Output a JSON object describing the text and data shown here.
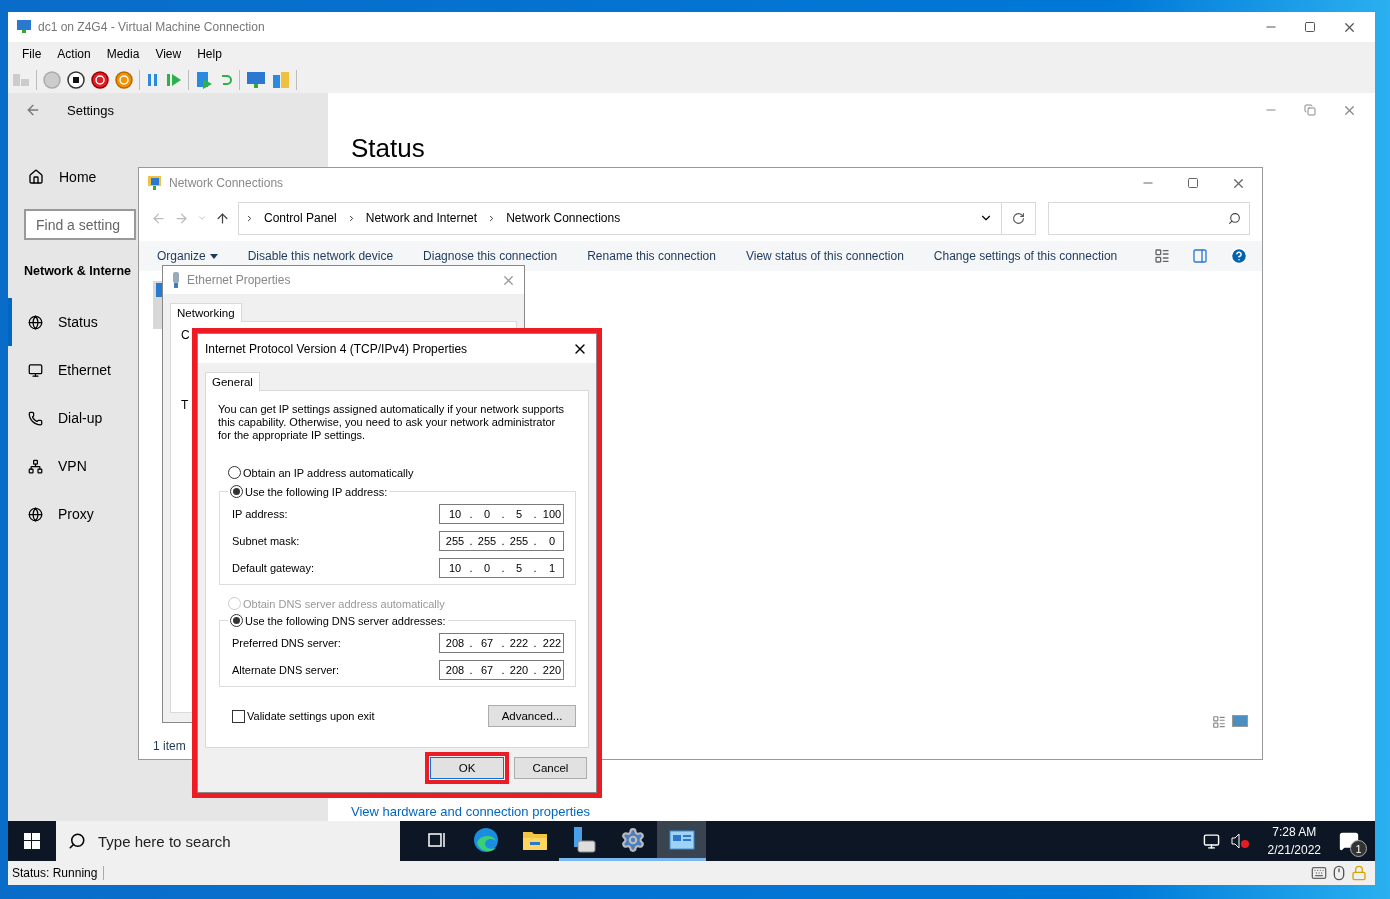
{
  "vm_window": {
    "title": "dc1 on Z4G4 - Virtual Machine Connection",
    "menu": [
      "File",
      "Action",
      "Media",
      "View",
      "Help"
    ],
    "status": "Status: Running"
  },
  "settings": {
    "title": "Settings",
    "home": "Home",
    "search": {
      "placeholder": "Find a setting"
    },
    "section": "Network & Interne",
    "heading": "Status",
    "link": "View hardware and connection properties",
    "nav": [
      {
        "label": "Status",
        "kind": "globe",
        "selected": true
      },
      {
        "label": "Ethernet",
        "kind": "ethernet",
        "selected": false
      },
      {
        "label": "Dial-up",
        "kind": "dialup",
        "selected": false
      },
      {
        "label": "VPN",
        "kind": "vpn",
        "selected": false
      },
      {
        "label": "Proxy",
        "kind": "globe",
        "selected": false
      }
    ]
  },
  "network_connections": {
    "title": "Network Connections",
    "breadcrumb": [
      "Control Panel",
      "Network and Internet",
      "Network Connections"
    ],
    "commands": [
      {
        "label": "Organize",
        "dropdown": true
      },
      {
        "label": "Disable this network device",
        "dropdown": false
      },
      {
        "label": "Diagnose this connection",
        "dropdown": false
      },
      {
        "label": "Rename this connection",
        "dropdown": false
      },
      {
        "label": "View status of this connection",
        "dropdown": false
      },
      {
        "label": "Change settings of this connection",
        "dropdown": false
      }
    ],
    "status": "1 item"
  },
  "ethernet_properties": {
    "title": "Ethernet Properties",
    "tabs": [
      {
        "label": "Networking",
        "selected": true
      }
    ],
    "fragments": [
      "C",
      "T"
    ]
  },
  "ipv4": {
    "title": "Internet Protocol Version 4 (TCP/IPv4) Properties",
    "tabs": [
      {
        "label": "General",
        "selected": true
      }
    ],
    "intro": "You can get IP settings assigned automatically if your network supports this capability. Otherwise, you need to ask your network administrator for the appropriate IP settings.",
    "separator": ".",
    "ip_auto": {
      "label": "Obtain an IP address automatically",
      "selected": false,
      "disabled": false
    },
    "ip_manual": {
      "label": "Use the following IP address:",
      "selected": true,
      "disabled": false
    },
    "ip_fields": [
      {
        "label": "IP address:",
        "octets": [
          "10",
          "0",
          "5",
          "100"
        ]
      },
      {
        "label": "Subnet mask:",
        "octets": [
          "255",
          "255",
          "255",
          "0"
        ]
      },
      {
        "label": "Default gateway:",
        "octets": [
          "10",
          "0",
          "5",
          "1"
        ]
      }
    ],
    "dns_auto": {
      "label": "Obtain DNS server address automatically",
      "selected": false,
      "disabled": true
    },
    "dns_manual": {
      "label": "Use the following DNS server addresses:",
      "selected": true,
      "disabled": false
    },
    "dns_fields": [
      {
        "label": "Preferred DNS server:",
        "octets": [
          "208",
          "67",
          "222",
          "222"
        ]
      },
      {
        "label": "Alternate DNS server:",
        "octets": [
          "208",
          "67",
          "220",
          "220"
        ]
      }
    ],
    "validate": {
      "label": "Validate settings upon exit",
      "checked": false
    },
    "advanced": "Advanced...",
    "ok": "OK",
    "cancel": "Cancel"
  },
  "taskbar": {
    "search": {
      "placeholder": "Type here to search"
    },
    "apps": [
      {
        "kind": "taskview",
        "running": false,
        "active": false
      },
      {
        "kind": "edge",
        "running": false,
        "active": false
      },
      {
        "kind": "explorer",
        "running": false,
        "active": false
      },
      {
        "kind": "server",
        "running": true,
        "active": false
      },
      {
        "kind": "settings",
        "running": true,
        "active": false
      },
      {
        "kind": "panel",
        "running": true,
        "active": true
      }
    ],
    "time": "7:28 AM",
    "date": "2/21/2022",
    "notifications": "1"
  }
}
